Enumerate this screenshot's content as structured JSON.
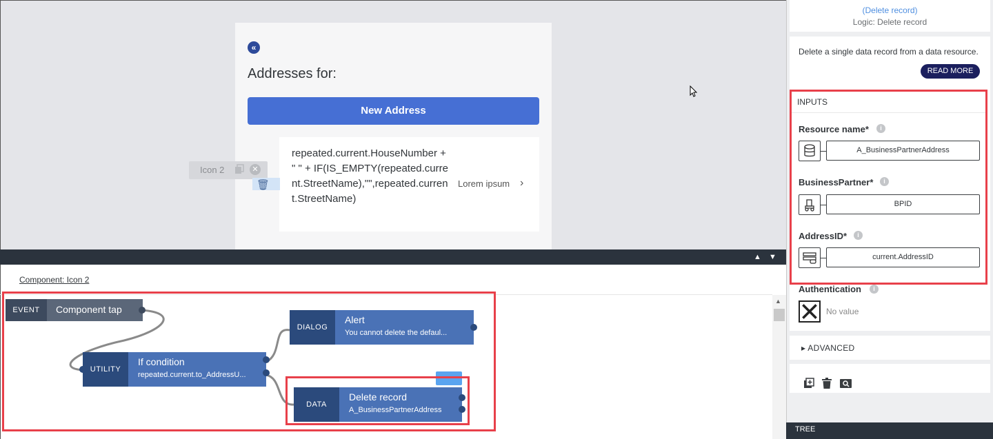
{
  "canvas": {
    "screen_title": "Addresses for:",
    "new_address_button": "New Address",
    "list_item_text": "repeated.current.HouseNumber + \" \" + IF(IS_EMPTY(repeated.current.StreetName),\"\",repeated.current.StreetName)",
    "list_item_extra": "Lorem ipsum",
    "selected_component_chip": "Icon 2"
  },
  "logic_editor": {
    "component_label": "Component: Icon 2",
    "nodes": {
      "event": {
        "type": "EVENT",
        "title": "Component tap"
      },
      "utility": {
        "type": "UTILITY",
        "title": "If condition",
        "subtitle": "repeated.current.to_AddressU..."
      },
      "dialog": {
        "type": "DIALOG",
        "title": "Alert",
        "subtitle": "You cannot delete the defaul..."
      },
      "data": {
        "type": "DATA",
        "title": "Delete record",
        "subtitle": "A_BusinessPartnerAddress"
      }
    }
  },
  "panel": {
    "link_text": "(Delete record)",
    "logic_label": "Logic: Delete record",
    "description": "Delete a single data record from a data resource.",
    "read_more": "READ MORE",
    "inputs_title": "INPUTS",
    "fields": [
      {
        "label": "Resource name*",
        "value": "A_BusinessPartnerAddress",
        "icon": "database-icon"
      },
      {
        "label": "BusinessPartner*",
        "value": "BPID",
        "icon": "forklift-icon"
      },
      {
        "label": "AddressID*",
        "value": "current.AddressID",
        "icon": "record-field-icon"
      }
    ],
    "auth_label": "Authentication",
    "auth_value": "No value",
    "advanced_label": "ADVANCED",
    "tree_label": "TREE"
  },
  "colors": {
    "accent": "#466fd4",
    "node_dark": "#2b4a7c",
    "node_light": "#4a72b6",
    "highlight": "#e8404a",
    "read_more_bg": "#1b1f5e"
  }
}
